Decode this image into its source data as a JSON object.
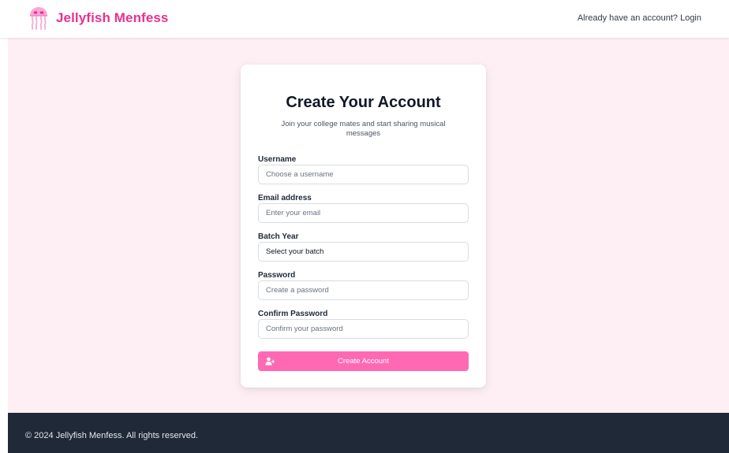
{
  "header": {
    "brand_name": "Jellyfish Menfess",
    "login_link": "Already have an account? Login"
  },
  "form": {
    "title": "Create Your Account",
    "subtitle": "Join your college mates and start sharing musical messages",
    "username": {
      "label": "Username",
      "placeholder": "Choose a username",
      "value": ""
    },
    "email": {
      "label": "Email address",
      "placeholder": "Enter your email",
      "value": ""
    },
    "batch": {
      "label": "Batch Year",
      "selected": "Select your batch"
    },
    "password": {
      "label": "Password",
      "placeholder": "Create a password",
      "value": ""
    },
    "confirm": {
      "label": "Confirm Password",
      "placeholder": "Confirm your password",
      "value": ""
    },
    "submit_label": "Create Account"
  },
  "footer": {
    "copyright": "© 2024 Jellyfish Menfess. All rights reserved."
  },
  "icons": {
    "brand": "jellyfish-icon",
    "submit": "user-plus-icon"
  },
  "colors": {
    "brand_pink": "#ec2f8e",
    "button_pink": "#ff69b4",
    "page_background": "#fdeff4",
    "footer_background": "#1f2937"
  }
}
